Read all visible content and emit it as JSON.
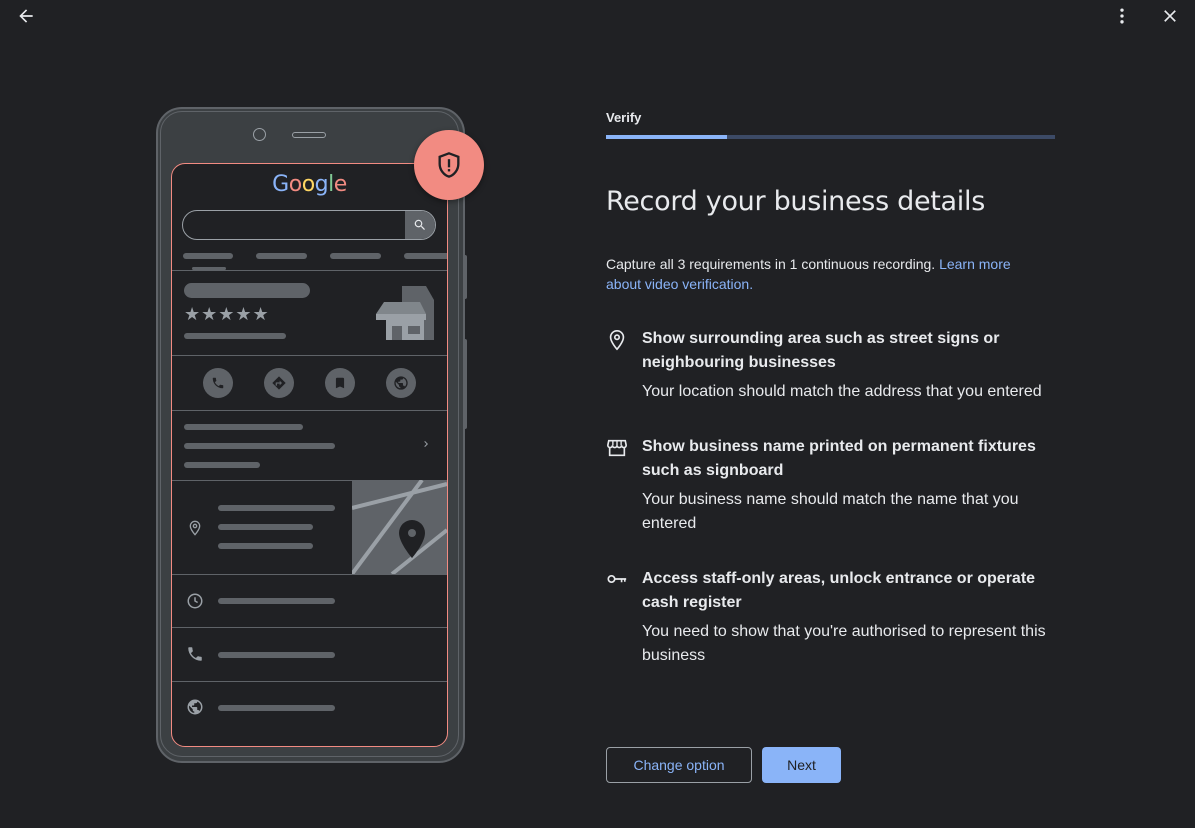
{
  "nav": {
    "back_icon": "arrow-left-icon",
    "menu_icon": "more-vert-icon",
    "close_icon": "close-icon"
  },
  "illustration": {
    "brand": [
      "G",
      "o",
      "o",
      "g",
      "l",
      "e"
    ],
    "brand_colors": [
      "#8ab4f8",
      "#f28b82",
      "#fdd663",
      "#8ab4f8",
      "#81c995",
      "#f28b82"
    ],
    "stars": "★★★★★",
    "shield_color": "#f28b82"
  },
  "verify": {
    "step_label": "Verify",
    "progress_fraction": 0.27,
    "title": "Record your business details",
    "intro_text": "Capture all 3 requirements in 1 continuous recording. ",
    "learn_more": "Learn more about video verification.",
    "requirements": [
      {
        "icon": "location-pin-icon",
        "title": "Show surrounding area such as street signs or neighbouring businesses",
        "description": "Your location should match the address that you entered"
      },
      {
        "icon": "storefront-icon",
        "title": "Show business name printed on permanent fixtures such as signboard",
        "description": "Your business name should match the name that you entered"
      },
      {
        "icon": "key-icon",
        "title": "Access staff-only areas, unlock entrance or operate cash register",
        "description": "You need to show that you're authorised to represent this business"
      }
    ],
    "buttons": {
      "change_option": "Change option",
      "next": "Next"
    }
  }
}
